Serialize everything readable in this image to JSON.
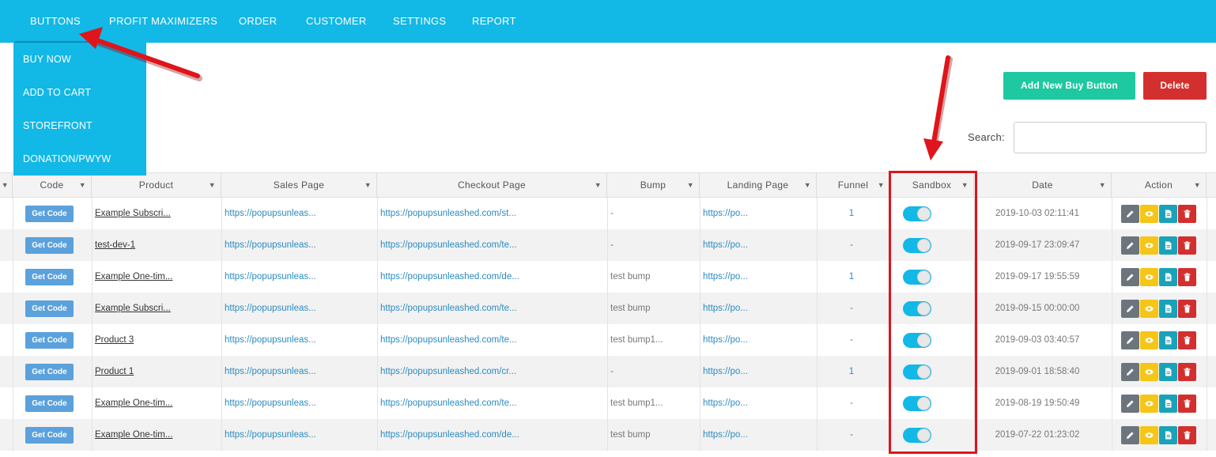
{
  "nav": {
    "items": [
      "BUTTONS",
      "PROFIT MAXIMIZERS",
      "ORDER",
      "CUSTOMER",
      "SETTINGS",
      "REPORT"
    ]
  },
  "dropdown": {
    "items": [
      "BUY NOW",
      "ADD TO CART",
      "STOREFRONT",
      "DONATION/PWYW"
    ]
  },
  "toolbar": {
    "add_label": "Add New Buy Button",
    "delete_label": "Delete",
    "search_label": "Search:",
    "search_value": ""
  },
  "table": {
    "columns": [
      "Code",
      "Product",
      "Sales Page",
      "Checkout Page",
      "Bump",
      "Landing Page",
      "Funnel",
      "Sandbox",
      "Date",
      "Action"
    ],
    "get_code_label": "Get Code",
    "rows": [
      {
        "product": "Example Subscri...",
        "sales": "https://popupsunleas...",
        "checkout": "https://popupsunleashed.com/st...",
        "bump": "-",
        "landing": "https://po...",
        "funnel": "1",
        "date": "2019-10-03 02:11:41"
      },
      {
        "product": "test-dev-1",
        "sales": "https://popupsunleas...",
        "checkout": "https://popupsunleashed.com/te...",
        "bump": "-",
        "landing": "https://po...",
        "funnel": "-",
        "date": "2019-09-17 23:09:47"
      },
      {
        "product": "Example One-tim...",
        "sales": "https://popupsunleas...",
        "checkout": "https://popupsunleashed.com/de...",
        "bump": "test bump",
        "landing": "https://po...",
        "funnel": "1",
        "date": "2019-09-17 19:55:59"
      },
      {
        "product": "Example Subscri...",
        "sales": "https://popupsunleas...",
        "checkout": "https://popupsunleashed.com/te...",
        "bump": "test bump",
        "landing": "https://po...",
        "funnel": "-",
        "date": "2019-09-15 00:00:00"
      },
      {
        "product": "Product 3",
        "sales": "https://popupsunleas...",
        "checkout": "https://popupsunleashed.com/te...",
        "bump": "test bump1...",
        "landing": "https://po...",
        "funnel": "-",
        "date": "2019-09-03 03:40:57"
      },
      {
        "product": "Product 1",
        "sales": "https://popupsunleas...",
        "checkout": "https://popupsunleashed.com/cr...",
        "bump": "-",
        "landing": "https://po...",
        "funnel": "1",
        "date": "2019-09-01 18:58:40"
      },
      {
        "product": "Example One-tim...",
        "sales": "https://popupsunleas...",
        "checkout": "https://popupsunleashed.com/te...",
        "bump": "test bump1...",
        "landing": "https://po...",
        "funnel": "-",
        "date": "2019-08-19 19:50:49"
      },
      {
        "product": "Example One-tim...",
        "sales": "https://popupsunleas...",
        "checkout": "https://popupsunleashed.com/de...",
        "bump": "test bump",
        "landing": "https://po...",
        "funnel": "-",
        "date": "2019-07-22 01:23:02"
      }
    ]
  },
  "icons": {
    "edit": "pencil-icon",
    "view": "eye-icon",
    "doc": "document-icon",
    "delete": "trash-icon",
    "sort": "chevron-down-icon",
    "sandbox": "toggle-switch"
  },
  "colors": {
    "nav": "#12b8e6",
    "add_button": "#1ec8a0",
    "delete_button": "#d32f2f",
    "get_code": "#5ba1dc",
    "link": "#2a8bbf",
    "annotation": "#e0141b"
  }
}
